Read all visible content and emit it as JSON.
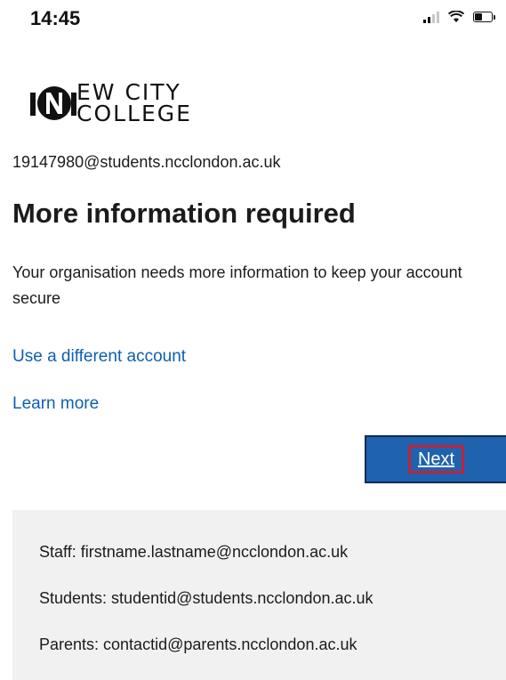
{
  "status_bar": {
    "time": "14:45"
  },
  "logo": {
    "line1": "EW CITY",
    "line2": "COLLEGE",
    "icon": "new-city-college-n-logo"
  },
  "account": {
    "email": "19147980@students.ncclondon.ac.uk"
  },
  "main": {
    "title": "More information required",
    "description": "Your organisation needs more information to keep your account secure",
    "use_different_account": "Use a different account",
    "learn_more": "Learn more",
    "next_label": "Next"
  },
  "info_panel": {
    "staff": "Staff: firstname.lastname@ncclondon.ac.uk",
    "students": "Students: studentid@students.ncclondon.ac.uk",
    "parents": "Parents: contactid@parents.ncclondon.ac.uk"
  },
  "colors": {
    "link": "#0f5fb0",
    "button": "#1f62ad",
    "highlight": "#c0233a",
    "panel": "#f1f1f1"
  }
}
